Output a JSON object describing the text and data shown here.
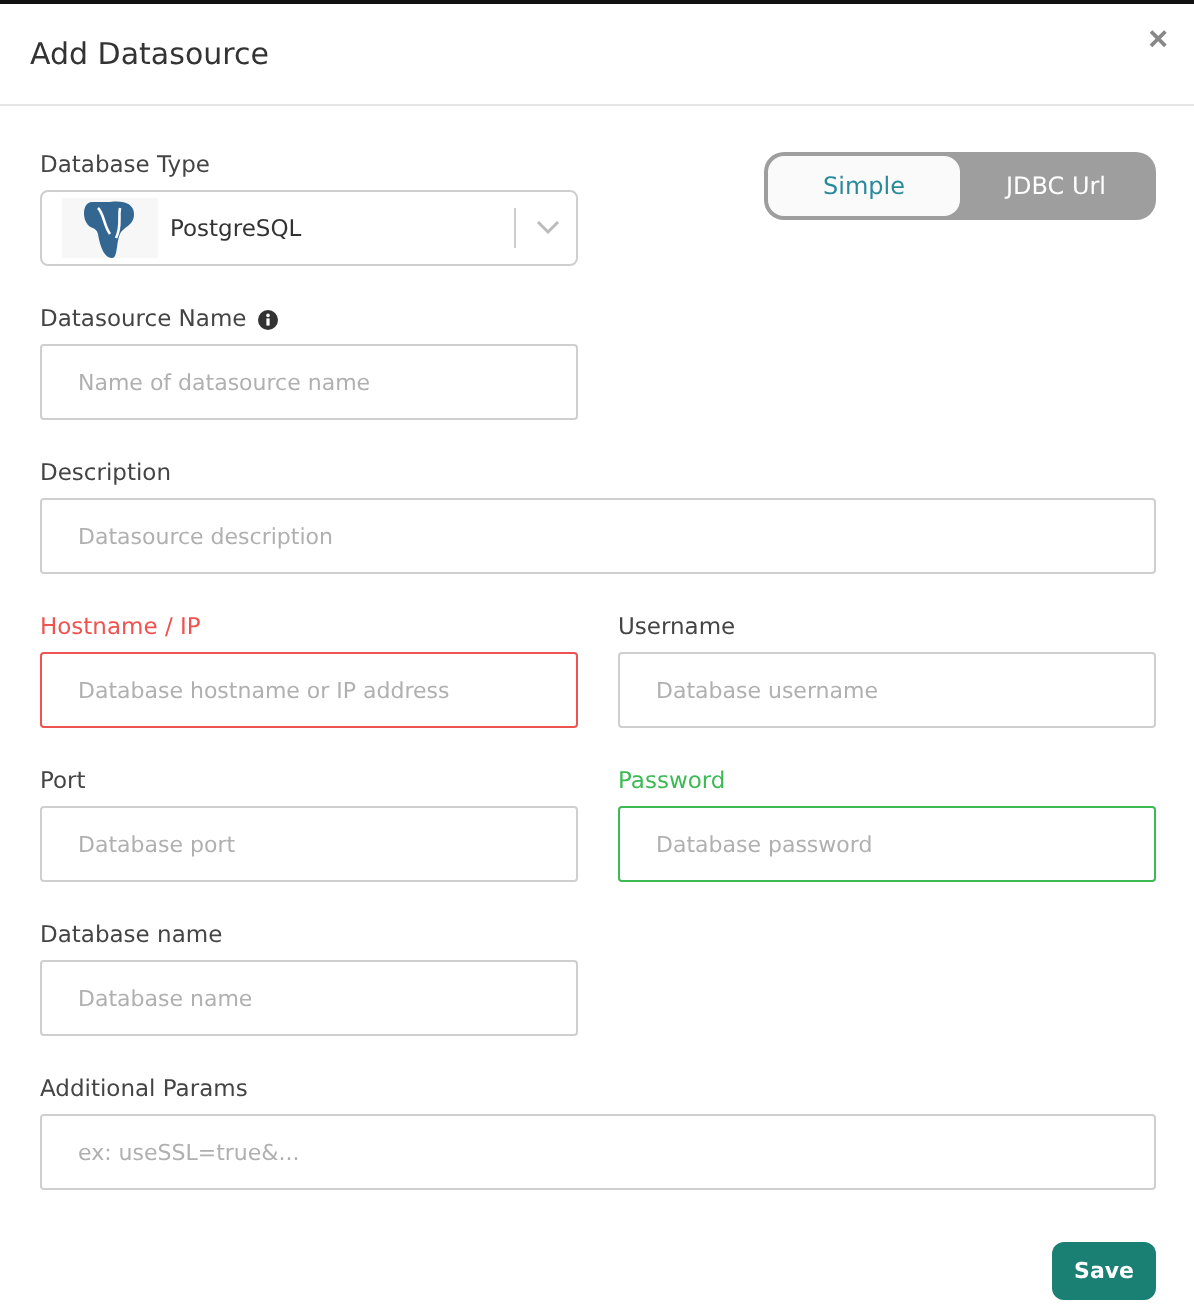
{
  "dialog": {
    "title": "Add Datasource",
    "close": "×"
  },
  "database_type": {
    "label": "Database Type",
    "value": "PostgreSQL"
  },
  "mode_toggle": [
    {
      "label": "Simple",
      "selected": true
    },
    {
      "label": "JDBC Url",
      "selected": false
    }
  ],
  "fields": [
    {
      "label": "Datasource Name",
      "placeholder": "Name of datasource name",
      "error": false,
      "valid": false,
      "wide": false,
      "info": true
    },
    {
      "label": "Description",
      "placeholder": "Datasource description",
      "error": false,
      "valid": false,
      "wide": true,
      "info": false
    },
    {
      "label": "Hostname / IP",
      "placeholder": "Database hostname or IP address",
      "error": true,
      "valid": false,
      "wide": false,
      "info": false
    },
    {
      "label": "Username",
      "placeholder": "Database username",
      "error": false,
      "valid": false,
      "wide": false,
      "info": false
    },
    {
      "label": "Port",
      "placeholder": "Database port",
      "error": false,
      "valid": false,
      "wide": false,
      "info": false
    },
    {
      "label": "Password",
      "placeholder": "Database password",
      "error": false,
      "valid": true,
      "wide": false,
      "info": false
    },
    {
      "label": "Database name",
      "placeholder": "Database name",
      "error": false,
      "valid": false,
      "wide": false,
      "info": false
    },
    {
      "label": "Additional Params",
      "placeholder": "ex: useSSL=true&...",
      "error": false,
      "valid": false,
      "wide": true,
      "info": false
    }
  ],
  "save_button": "Save"
}
